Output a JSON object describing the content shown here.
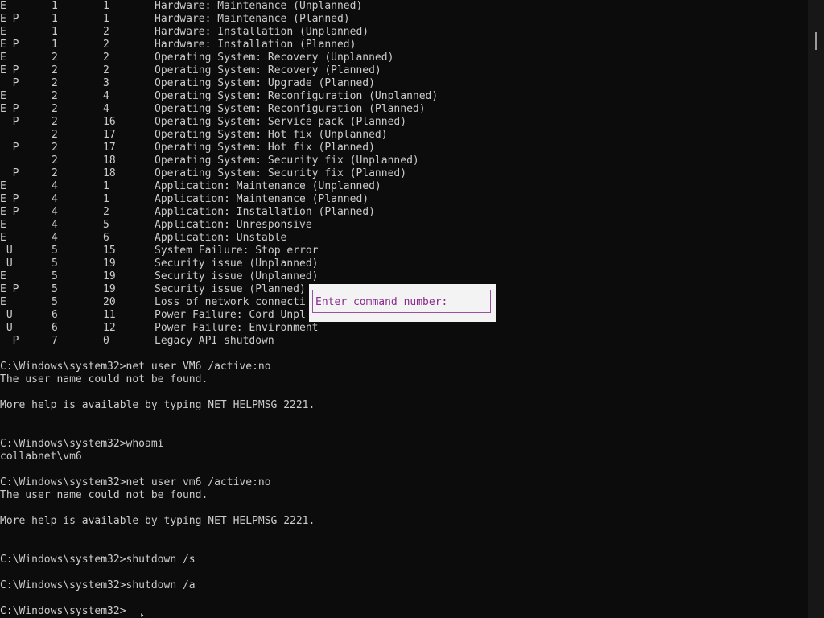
{
  "table_rows": [
    {
      "flags": "E",
      "major": "1",
      "minor": "1",
      "desc": "Hardware: Maintenance (Unplanned)"
    },
    {
      "flags": "E P",
      "major": "1",
      "minor": "1",
      "desc": "Hardware: Maintenance (Planned)"
    },
    {
      "flags": "E",
      "major": "1",
      "minor": "2",
      "desc": "Hardware: Installation (Unplanned)"
    },
    {
      "flags": "E P",
      "major": "1",
      "minor": "2",
      "desc": "Hardware: Installation (Planned)"
    },
    {
      "flags": "E",
      "major": "2",
      "minor": "2",
      "desc": "Operating System: Recovery (Unplanned)"
    },
    {
      "flags": "E P",
      "major": "2",
      "minor": "2",
      "desc": "Operating System: Recovery (Planned)"
    },
    {
      "flags": "  P",
      "major": "2",
      "minor": "3",
      "desc": "Operating System: Upgrade (Planned)"
    },
    {
      "flags": "E",
      "major": "2",
      "minor": "4",
      "desc": "Operating System: Reconfiguration (Unplanned)"
    },
    {
      "flags": "E P",
      "major": "2",
      "minor": "4",
      "desc": "Operating System: Reconfiguration (Planned)"
    },
    {
      "flags": "  P",
      "major": "2",
      "minor": "16",
      "desc": "Operating System: Service pack (Planned)"
    },
    {
      "flags": "",
      "major": "2",
      "minor": "17",
      "desc": "Operating System: Hot fix (Unplanned)"
    },
    {
      "flags": "  P",
      "major": "2",
      "minor": "17",
      "desc": "Operating System: Hot fix (Planned)"
    },
    {
      "flags": "",
      "major": "2",
      "minor": "18",
      "desc": "Operating System: Security fix (Unplanned)"
    },
    {
      "flags": "  P",
      "major": "2",
      "minor": "18",
      "desc": "Operating System: Security fix (Planned)"
    },
    {
      "flags": "E",
      "major": "4",
      "minor": "1",
      "desc": "Application: Maintenance (Unplanned)"
    },
    {
      "flags": "E P",
      "major": "4",
      "minor": "1",
      "desc": "Application: Maintenance (Planned)"
    },
    {
      "flags": "E P",
      "major": "4",
      "minor": "2",
      "desc": "Application: Installation (Planned)"
    },
    {
      "flags": "E",
      "major": "4",
      "minor": "5",
      "desc": "Application: Unresponsive"
    },
    {
      "flags": "E",
      "major": "4",
      "minor": "6",
      "desc": "Application: Unstable"
    },
    {
      "flags": " U",
      "major": "5",
      "minor": "15",
      "desc": "System Failure: Stop error"
    },
    {
      "flags": " U",
      "major": "5",
      "minor": "19",
      "desc": "Security issue (Unplanned)"
    },
    {
      "flags": "E",
      "major": "5",
      "minor": "19",
      "desc": "Security issue (Unplanned)"
    },
    {
      "flags": "E P",
      "major": "5",
      "minor": "19",
      "desc": "Security issue (Planned)"
    },
    {
      "flags": "E",
      "major": "5",
      "minor": "20",
      "desc": "Loss of network connecti"
    },
    {
      "flags": " U",
      "major": "6",
      "minor": "11",
      "desc": "Power Failure: Cord Unpl"
    },
    {
      "flags": " U",
      "major": "6",
      "minor": "12",
      "desc": "Power Failure: Environment"
    },
    {
      "flags": "  P",
      "major": "7",
      "minor": "0",
      "desc": "Legacy API shutdown"
    }
  ],
  "session_lines": [
    "",
    "C:\\Windows\\system32>net user VM6 /active:no",
    "The user name could not be found.",
    "",
    "More help is available by typing NET HELPMSG 2221.",
    "",
    "",
    "C:\\Windows\\system32>whoami",
    "collabnet\\vm6",
    "",
    "C:\\Windows\\system32>net user vm6 /active:no",
    "The user name could not be found.",
    "",
    "More help is available by typing NET HELPMSG 2221.",
    "",
    "",
    "C:\\Windows\\system32>shutdown /s",
    "",
    "C:\\Windows\\system32>shutdown /a",
    "",
    "C:\\Windows\\system32>"
  ],
  "dialog": {
    "label": "Enter command number:"
  },
  "colors": {
    "console_background": "#0c0c0c",
    "console_text": "#cccccc",
    "dialog_background": "#f3f3f3",
    "dialog_accent": "#9b4fa3"
  }
}
